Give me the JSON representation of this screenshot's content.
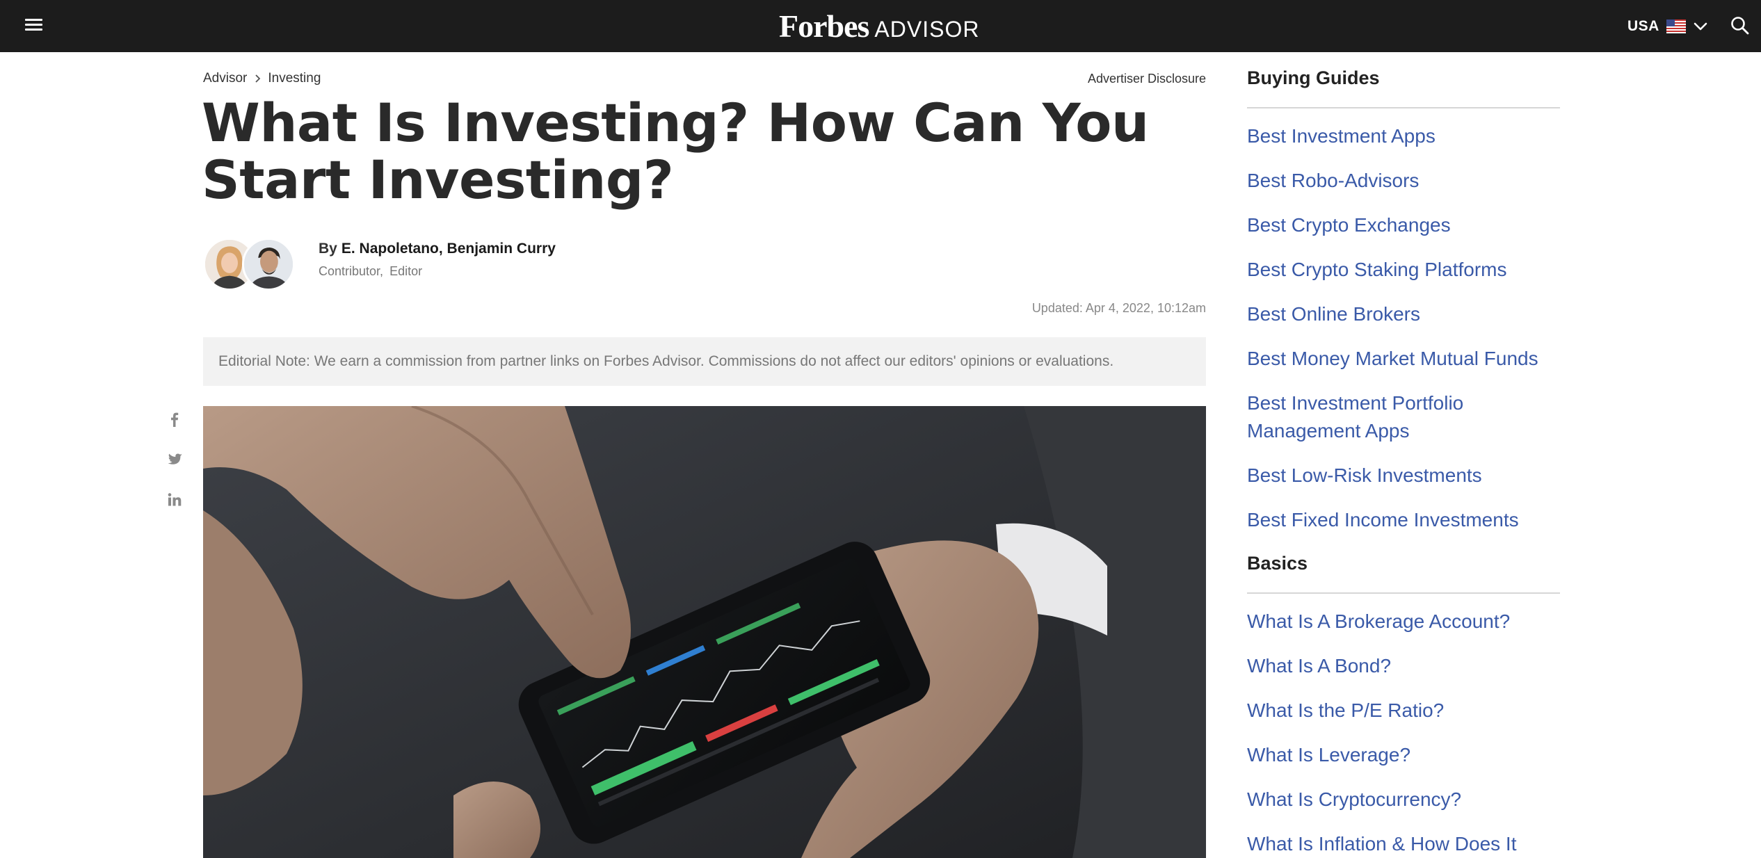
{
  "header": {
    "logo_forbes": "Forbes",
    "logo_advisor": "ADVISOR",
    "region_label": "USA",
    "icons": [
      "menu-icon",
      "flag-icon",
      "chevron-down-icon",
      "search-icon"
    ]
  },
  "breadcrumb": {
    "items": [
      "Advisor",
      "Investing"
    ]
  },
  "disclosure": "Advertiser Disclosure",
  "article": {
    "title": "What Is Investing? How Can You Start Investing?",
    "by_label": "By",
    "authors": "E. Napoletano, Benjamin Curry",
    "roles": [
      "Contributor,",
      "Editor"
    ],
    "updated": "Updated: Apr 4, 2022, 10:12am",
    "editorial_note": "Editorial Note: We earn a commission from partner links on Forbes Advisor. Commissions do not affect our editors' opinions or evaluations."
  },
  "share_icons": [
    "facebook-icon",
    "twitter-icon",
    "linkedin-icon"
  ],
  "sidebar": {
    "buying_guides": {
      "heading": "Buying Guides",
      "links": [
        "Best Investment Apps",
        "Best Robo-Advisors",
        "Best Crypto Exchanges",
        "Best Crypto Staking Platforms",
        "Best Online Brokers",
        "Best Money Market Mutual Funds",
        "Best Investment Portfolio Management Apps",
        "Best Low-Risk Investments",
        "Best Fixed Income Investments"
      ]
    },
    "basics": {
      "heading": "Basics",
      "links": [
        "What Is A Brokerage Account?",
        "What Is A Bond?",
        "What Is the P/E Ratio?",
        "What Is Leverage?",
        "What Is Cryptocurrency?",
        "What Is Inflation & How Does It"
      ]
    }
  },
  "colors": {
    "topbar": "#1c1c1c",
    "link": "#3a5aa8",
    "note_bg": "#f2f2f2"
  }
}
